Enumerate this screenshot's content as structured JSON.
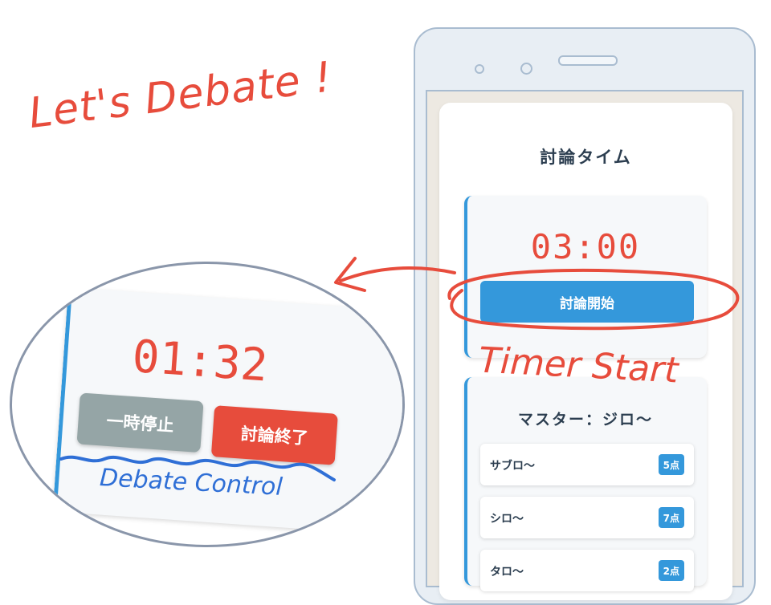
{
  "annotations": {
    "headline": "Let's Debate !",
    "callout_start": "Timer Start",
    "callout_control": "Debate Control"
  },
  "app": {
    "title": "討論タイム",
    "timer": {
      "value": "03:00",
      "start_button": "討論開始"
    },
    "score": {
      "master_label": "マスター：ジロ〜",
      "players": [
        {
          "name": "サブロ〜",
          "points": "5点"
        },
        {
          "name": "シロ〜",
          "points": "7点"
        },
        {
          "name": "タロ〜",
          "points": "2点"
        }
      ]
    }
  },
  "zoom": {
    "timer_value": "01:32",
    "pause_button": "一時停止",
    "end_button": "討論終了"
  },
  "colors": {
    "accent_blue": "#3498db",
    "accent_red": "#e74c3c",
    "pause_gray": "#95a5a6",
    "frame": "#a9bcd0"
  }
}
